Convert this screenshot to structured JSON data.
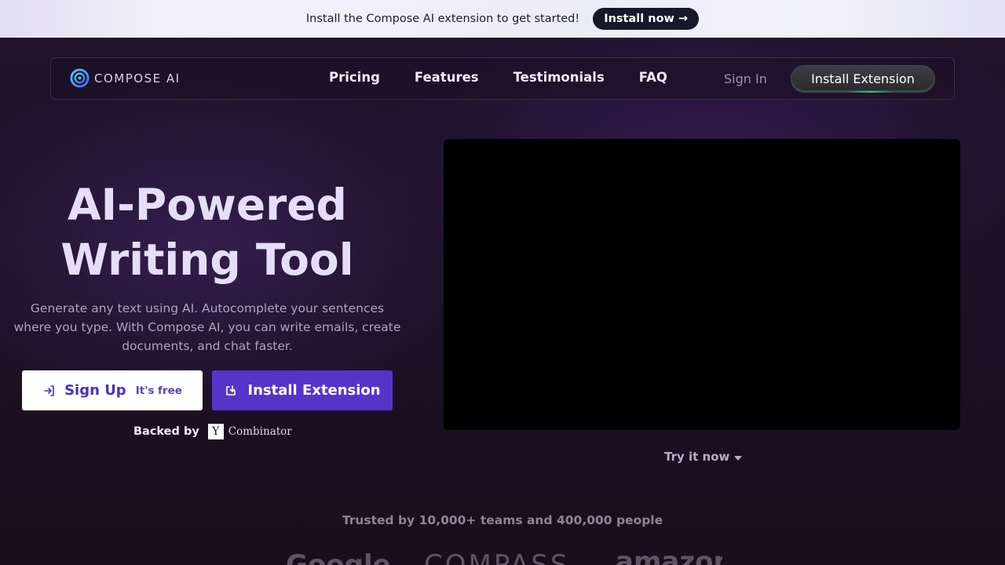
{
  "banner": {
    "text": "Install the Compose AI extension to get started!",
    "button_label": "Install now →"
  },
  "nav": {
    "logo_text": "COMPOSE AI",
    "links": [
      "Pricing",
      "Features",
      "Testimonials",
      "FAQ"
    ],
    "signin": "Sign In",
    "install": "Install Extension"
  },
  "hero": {
    "title_line1": "AI-Powered",
    "title_line2": "Writing Tool",
    "subtitle": "Generate any text using AI. Autocomplete your sentences where you type. With Compose AI, you can write emails, create documents, and chat faster.",
    "signup_label": "Sign Up",
    "signup_badge": "It's free",
    "install_label": "Install Extension",
    "backed_by": "Backed by",
    "yc_letter": "Y",
    "yc_text": "Combinator"
  },
  "video": {
    "try_label": "Try it now"
  },
  "trusted": {
    "text": "Trusted by 10,000+ teams and 400,000 people",
    "logos": [
      "Google",
      "COMPASS",
      "amazon"
    ]
  },
  "colors": {
    "accent": "#5734c9",
    "background": "#1b0f22",
    "banner_button": "#17182a"
  }
}
